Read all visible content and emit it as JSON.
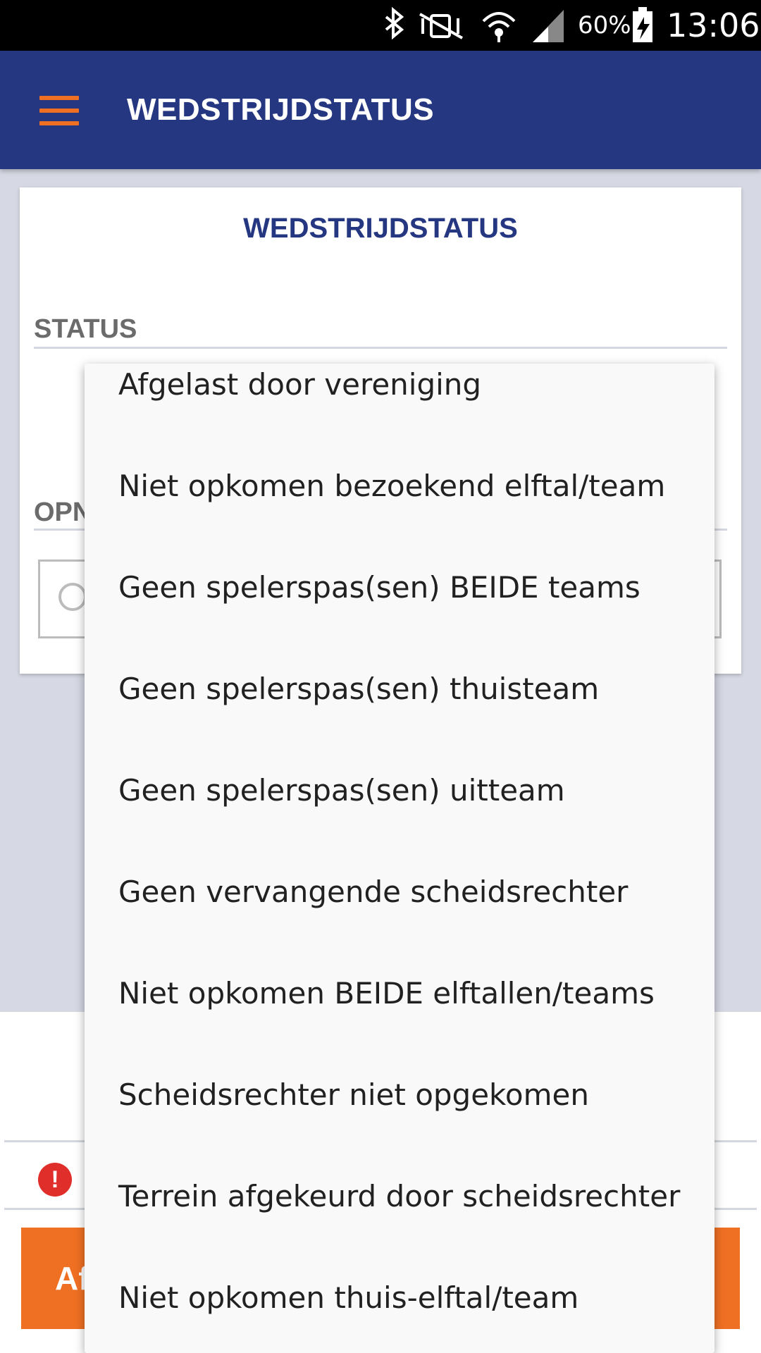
{
  "status_bar": {
    "battery_percent": "60%",
    "time": "13:06",
    "icons": [
      "bluetooth-icon",
      "vibrate-icon",
      "wifi-icon",
      "signal-icon",
      "battery-charging-icon"
    ]
  },
  "app_bar": {
    "menu_icon": "hamburger-menu-icon",
    "title": "WEDSTRIJDSTATUS"
  },
  "card": {
    "title": "WEDSTRIJDSTATUS",
    "status_label": "STATUS",
    "remarks_label_partial": "OPN"
  },
  "bottom": {
    "error_icon": "error-icon",
    "error_symbol": "!",
    "button_label_partial": "Af"
  },
  "dropdown": {
    "options": [
      "Afgelast door vereniging",
      "Niet opkomen bezoekend elftal/team",
      "Geen spelerspas(sen) BEIDE teams",
      "Geen spelerspas(sen) thuisteam",
      "Geen spelerspas(sen) uitteam",
      "Geen vervangende scheidsrechter",
      "Niet opkomen BEIDE elftallen/teams",
      "Scheidsrechter niet opgekomen",
      "Terrein afgekeurd door scheidsrechter",
      "Niet opkomen thuis-elftal/team"
    ]
  },
  "colors": {
    "primary": "#263782",
    "accent": "#f07023",
    "error": "#e02e2a"
  }
}
